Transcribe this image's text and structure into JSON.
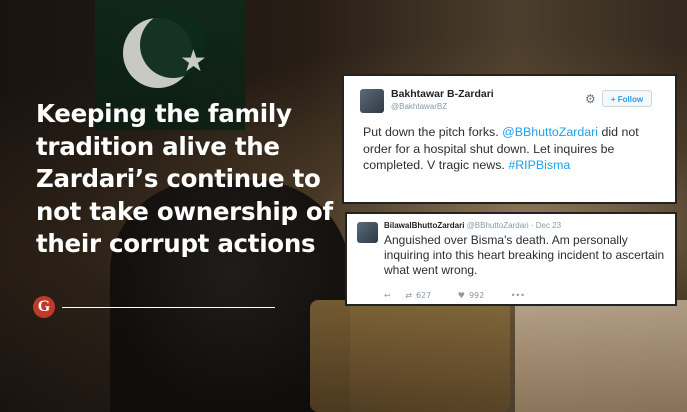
{
  "headline": {
    "lines": [
      "Keeping the family",
      "tradition alive the",
      "Zardari’s continue to",
      "not take ownership of",
      "their corrupt actions"
    ]
  },
  "brand": {
    "letter": "G"
  },
  "tweet1": {
    "name": "Bakhtawar B-Zardari",
    "handle": "@BakhtawarBZ",
    "follow_label": "Follow",
    "text_before": "Put down the pitch forks. ",
    "mention": "@BBhuttoZardari",
    "text_after": " did not order for a hospital shut down. Let inquires be completed. V tragic news. ",
    "hashtag": "#RIPBisma"
  },
  "tweet2": {
    "name": "BilawalBhuttoZardari",
    "handle": "@BBhuttoZardari",
    "separator": " · ",
    "date": "Dec 23",
    "text": "Anguished over Bisma's death. Am personally inquiring into this heart breaking incident to ascertain what went wrong.",
    "retweets": "627",
    "likes": "992"
  },
  "colors": {
    "link": "#1da1f2",
    "brand": "#c0392b"
  }
}
